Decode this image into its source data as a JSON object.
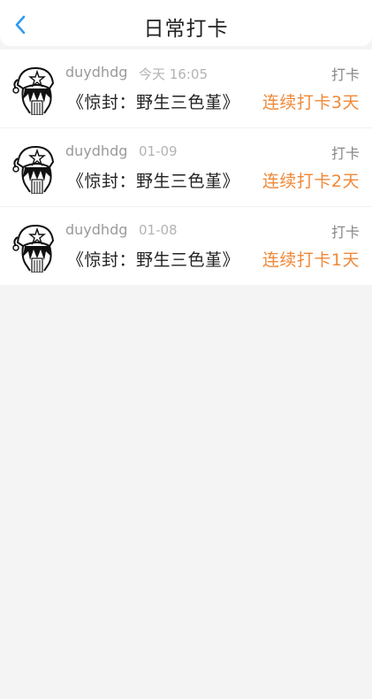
{
  "header": {
    "title": "日常打卡",
    "back_icon": "chevron-left-icon",
    "accent_color": "#2f9bf0"
  },
  "records": [
    {
      "username": "duydhdg",
      "time": "今天 16:05",
      "action": "打卡",
      "book": "《惊封：野生三色堇》",
      "streak": "连续打卡3天"
    },
    {
      "username": "duydhdg",
      "time": "01-09",
      "action": "打卡",
      "book": "《惊封：野生三色堇》",
      "streak": "连续打卡2天"
    },
    {
      "username": "duydhdg",
      "time": "01-08",
      "action": "打卡",
      "book": "《惊封：野生三色堇》",
      "streak": "连续打卡1天"
    }
  ],
  "colors": {
    "streak": "#f08838",
    "background": "#f4f4f4"
  }
}
